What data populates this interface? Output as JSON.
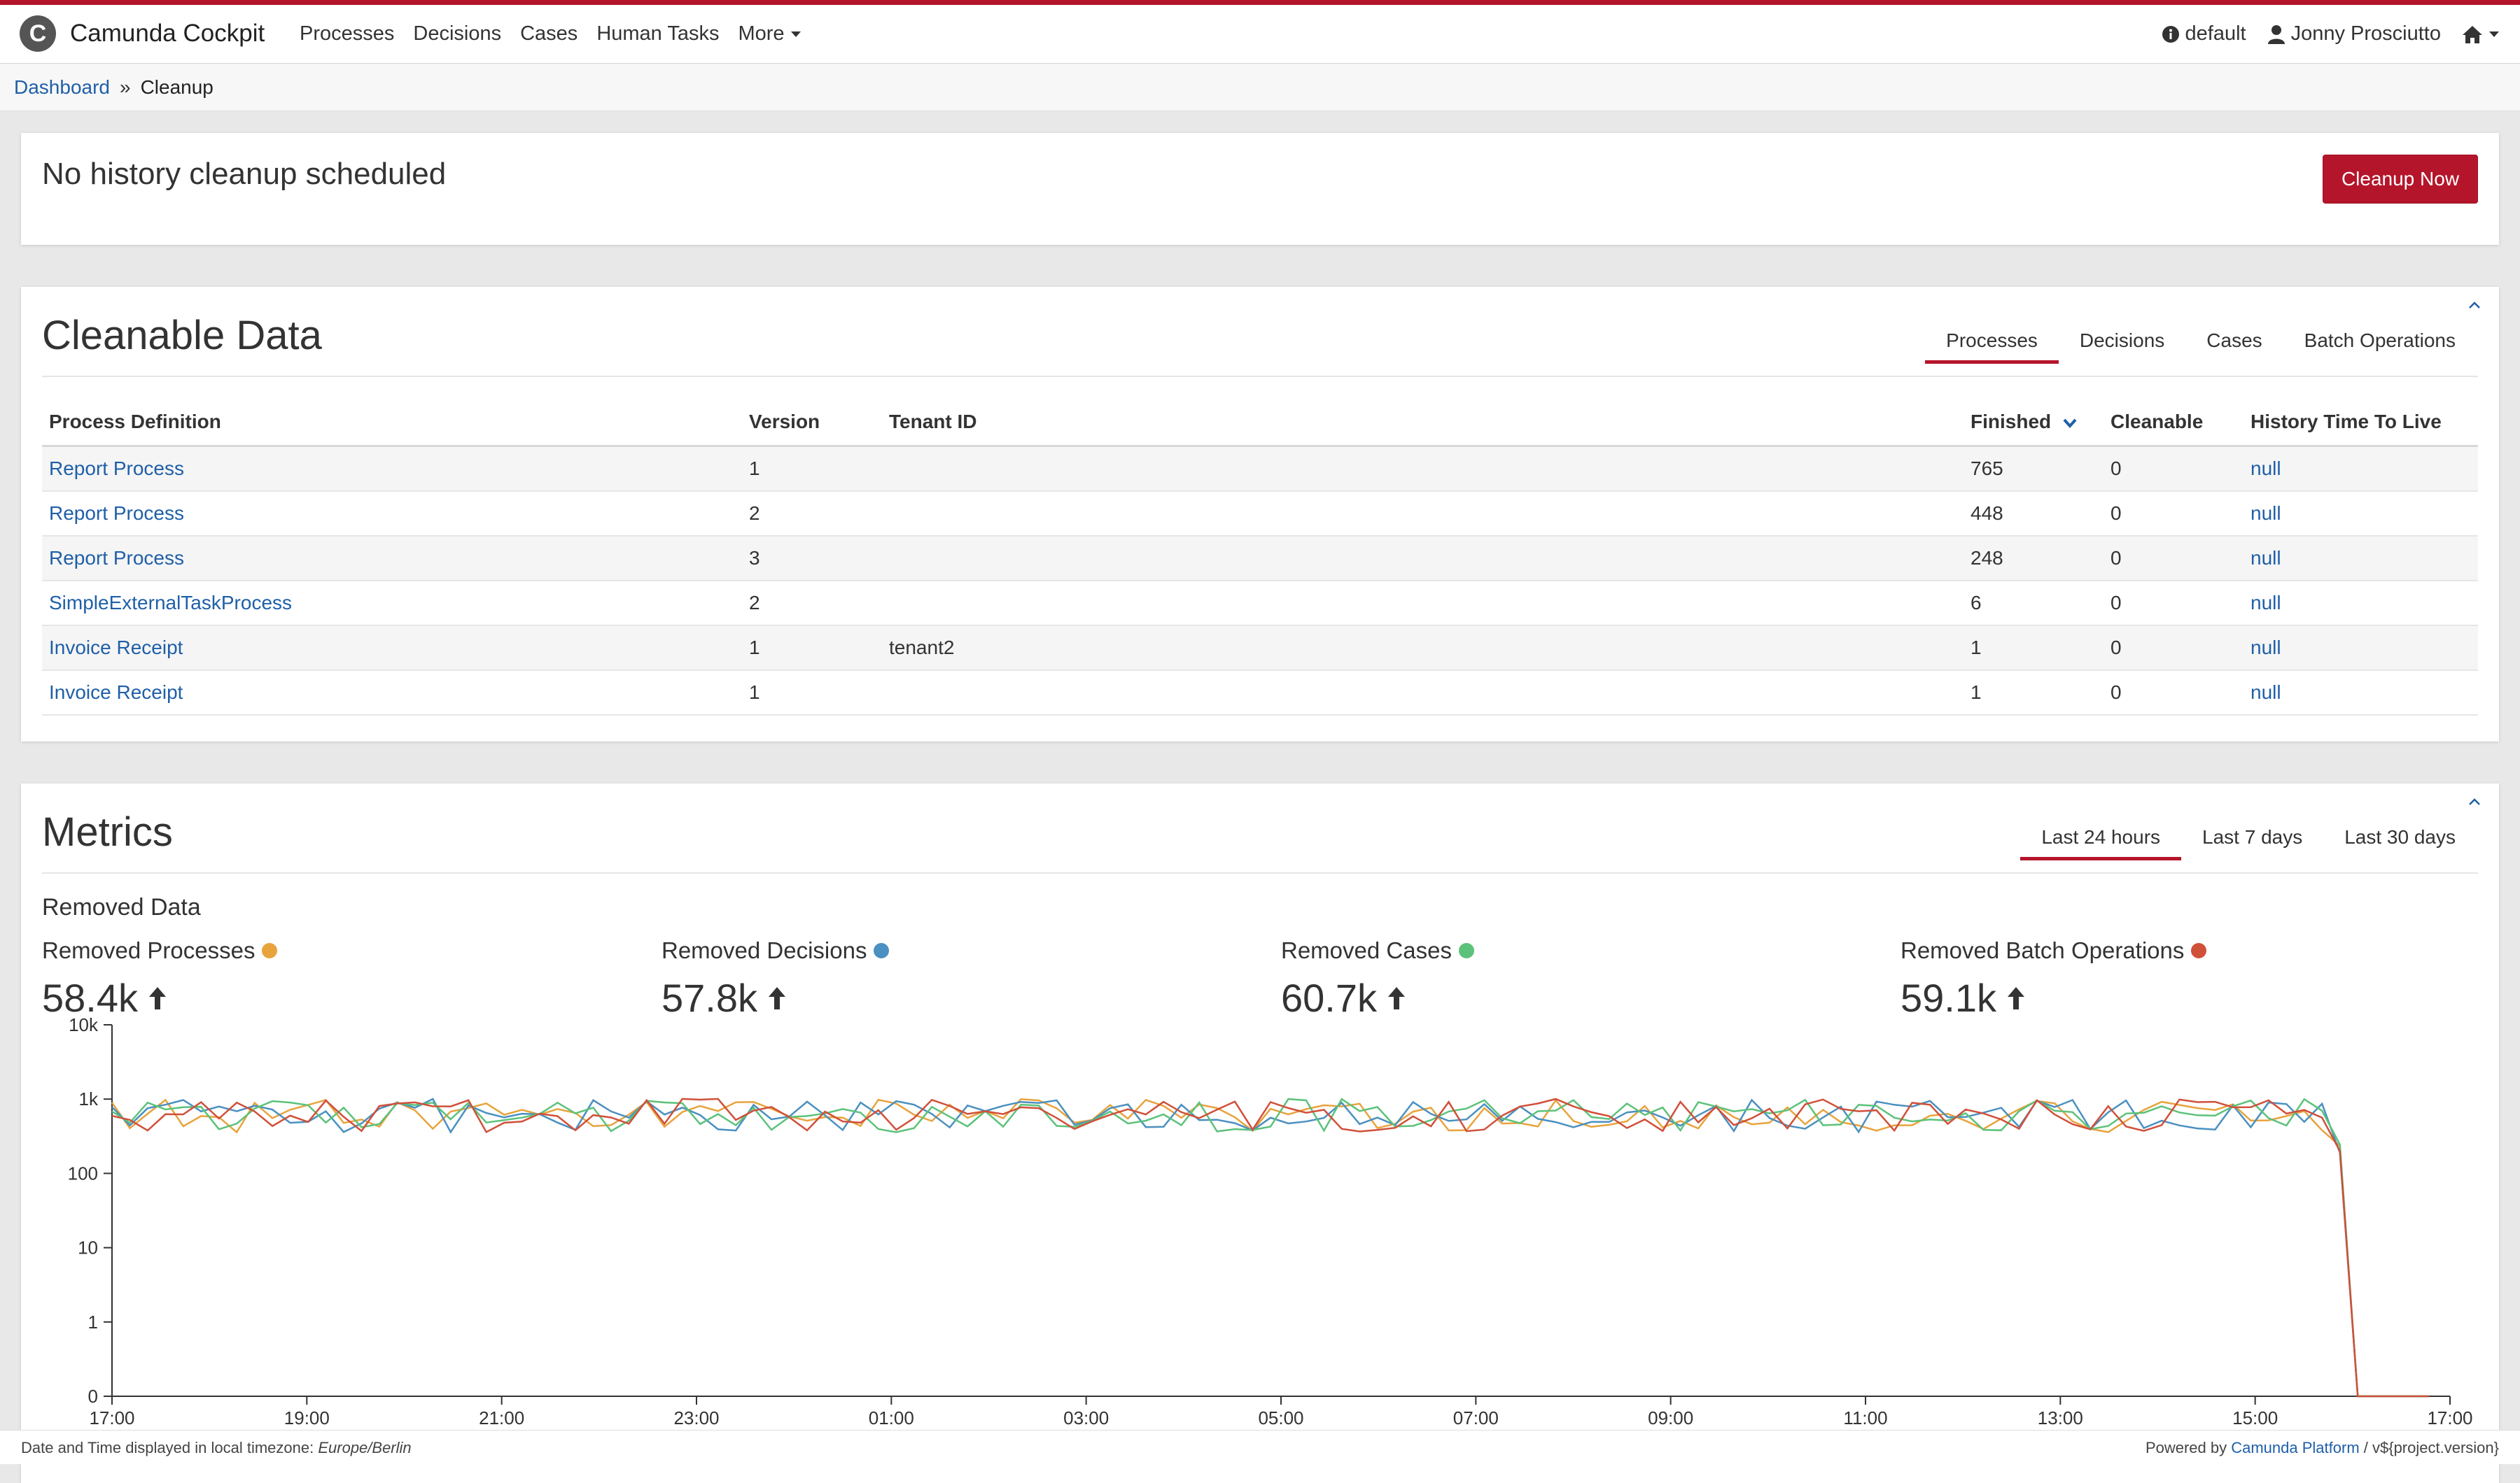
{
  "app": {
    "name": "Camunda Cockpit",
    "logo_letter": "C",
    "accent": "#b5152b"
  },
  "nav": {
    "items": [
      "Processes",
      "Decisions",
      "Cases",
      "Human Tasks"
    ],
    "more_label": "More",
    "engine": "default",
    "user": "Jonny Prosciutto"
  },
  "breadcrumb": {
    "parent": "Dashboard",
    "separator": "»",
    "current": "Cleanup"
  },
  "status": {
    "text": "No history cleanup scheduled",
    "button": "Cleanup Now"
  },
  "cleanable": {
    "title": "Cleanable Data",
    "tabs": [
      "Processes",
      "Decisions",
      "Cases",
      "Batch Operations"
    ],
    "active_tab": "Processes",
    "columns": [
      "Process Definition",
      "Version",
      "Tenant ID",
      "Finished",
      "Cleanable",
      "History Time To Live"
    ],
    "sorted_column": "Finished",
    "rows": [
      {
        "definition": "Report Process",
        "version": "1",
        "tenant": "",
        "finished": "765",
        "cleanable": "0",
        "ttl": "null"
      },
      {
        "definition": "Report Process",
        "version": "2",
        "tenant": "",
        "finished": "448",
        "cleanable": "0",
        "ttl": "null"
      },
      {
        "definition": "Report Process",
        "version": "3",
        "tenant": "",
        "finished": "248",
        "cleanable": "0",
        "ttl": "null"
      },
      {
        "definition": "SimpleExternalTaskProcess",
        "version": "2",
        "tenant": "",
        "finished": "6",
        "cleanable": "0",
        "ttl": "null"
      },
      {
        "definition": "Invoice Receipt",
        "version": "1",
        "tenant": "tenant2",
        "finished": "1",
        "cleanable": "0",
        "ttl": "null"
      },
      {
        "definition": "Invoice Receipt",
        "version": "1",
        "tenant": "",
        "finished": "1",
        "cleanable": "0",
        "ttl": "null"
      }
    ]
  },
  "metrics": {
    "title": "Metrics",
    "tabs": [
      "Last 24 hours",
      "Last 7 days",
      "Last 30 days"
    ],
    "active_tab": "Last 24 hours",
    "subtitle": "Removed Data",
    "cards": [
      {
        "label": "Removed Processes",
        "value": "58.4k",
        "color": "#e8a33d"
      },
      {
        "label": "Removed Decisions",
        "value": "57.8k",
        "color": "#4a90c0"
      },
      {
        "label": "Removed Cases",
        "value": "60.7k",
        "color": "#5cc27a"
      },
      {
        "label": "Removed Batch Operations",
        "value": "59.1k",
        "color": "#d0503a"
      }
    ]
  },
  "chart_data": {
    "type": "line",
    "yscale": "log",
    "y_ticks": [
      "0",
      "1",
      "10",
      "100",
      "1k",
      "10k"
    ],
    "x_ticks": [
      "17:00",
      "19:00",
      "21:00",
      "23:00",
      "01:00",
      "03:00",
      "05:00",
      "07:00",
      "09:00",
      "11:00",
      "13:00",
      "15:00",
      "17:00"
    ],
    "baseline": 600,
    "series": [
      {
        "color": "#e8a33d"
      },
      {
        "color": "#4a90c0"
      },
      {
        "color": "#5cc27a"
      },
      {
        "color": "#d0503a"
      }
    ],
    "note": "Each series fluctuates roughly between 300 and 1.2k removals per interval and drops to 0 near 16:40"
  },
  "footer": {
    "tz_prefix": "Date and Time displayed in local timezone: ",
    "tz": "Europe/Berlin",
    "powered_prefix": "Powered by ",
    "powered_link": "Camunda Platform",
    "version": " / v${project.version}"
  }
}
